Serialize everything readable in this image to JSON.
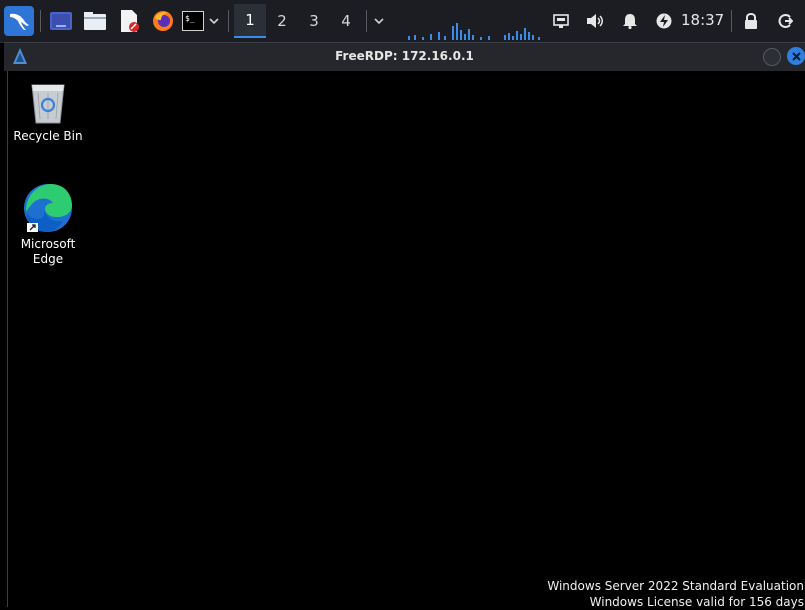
{
  "panel": {
    "workspaces": [
      "1",
      "2",
      "3",
      "4"
    ],
    "active_workspace": "1",
    "clock": "18:37",
    "launchers": [
      "kali-menu-icon",
      "desktop-icon",
      "file-manager-icon",
      "text-editor-icon",
      "firefox-icon",
      "terminal-icon"
    ],
    "tray": [
      "network-icon",
      "volume-icon",
      "notification-bell-icon",
      "power-icon",
      "lock-icon",
      "logout-icon"
    ]
  },
  "window": {
    "title": "FreeRDP: 172.16.0.1"
  },
  "desktop": {
    "icons": [
      {
        "label": "Recycle Bin"
      },
      {
        "label": "Microsoft\nEdge"
      }
    ],
    "watermark_line1": "Windows Server 2022 Standard Evaluation",
    "watermark_line2": "Windows License valid for 156 days"
  },
  "colors": {
    "panel_bg": "#1b1d22",
    "accent": "#3b8ce8",
    "kali_blue": "#2f75d6",
    "close_button": "#2f7fe0"
  }
}
